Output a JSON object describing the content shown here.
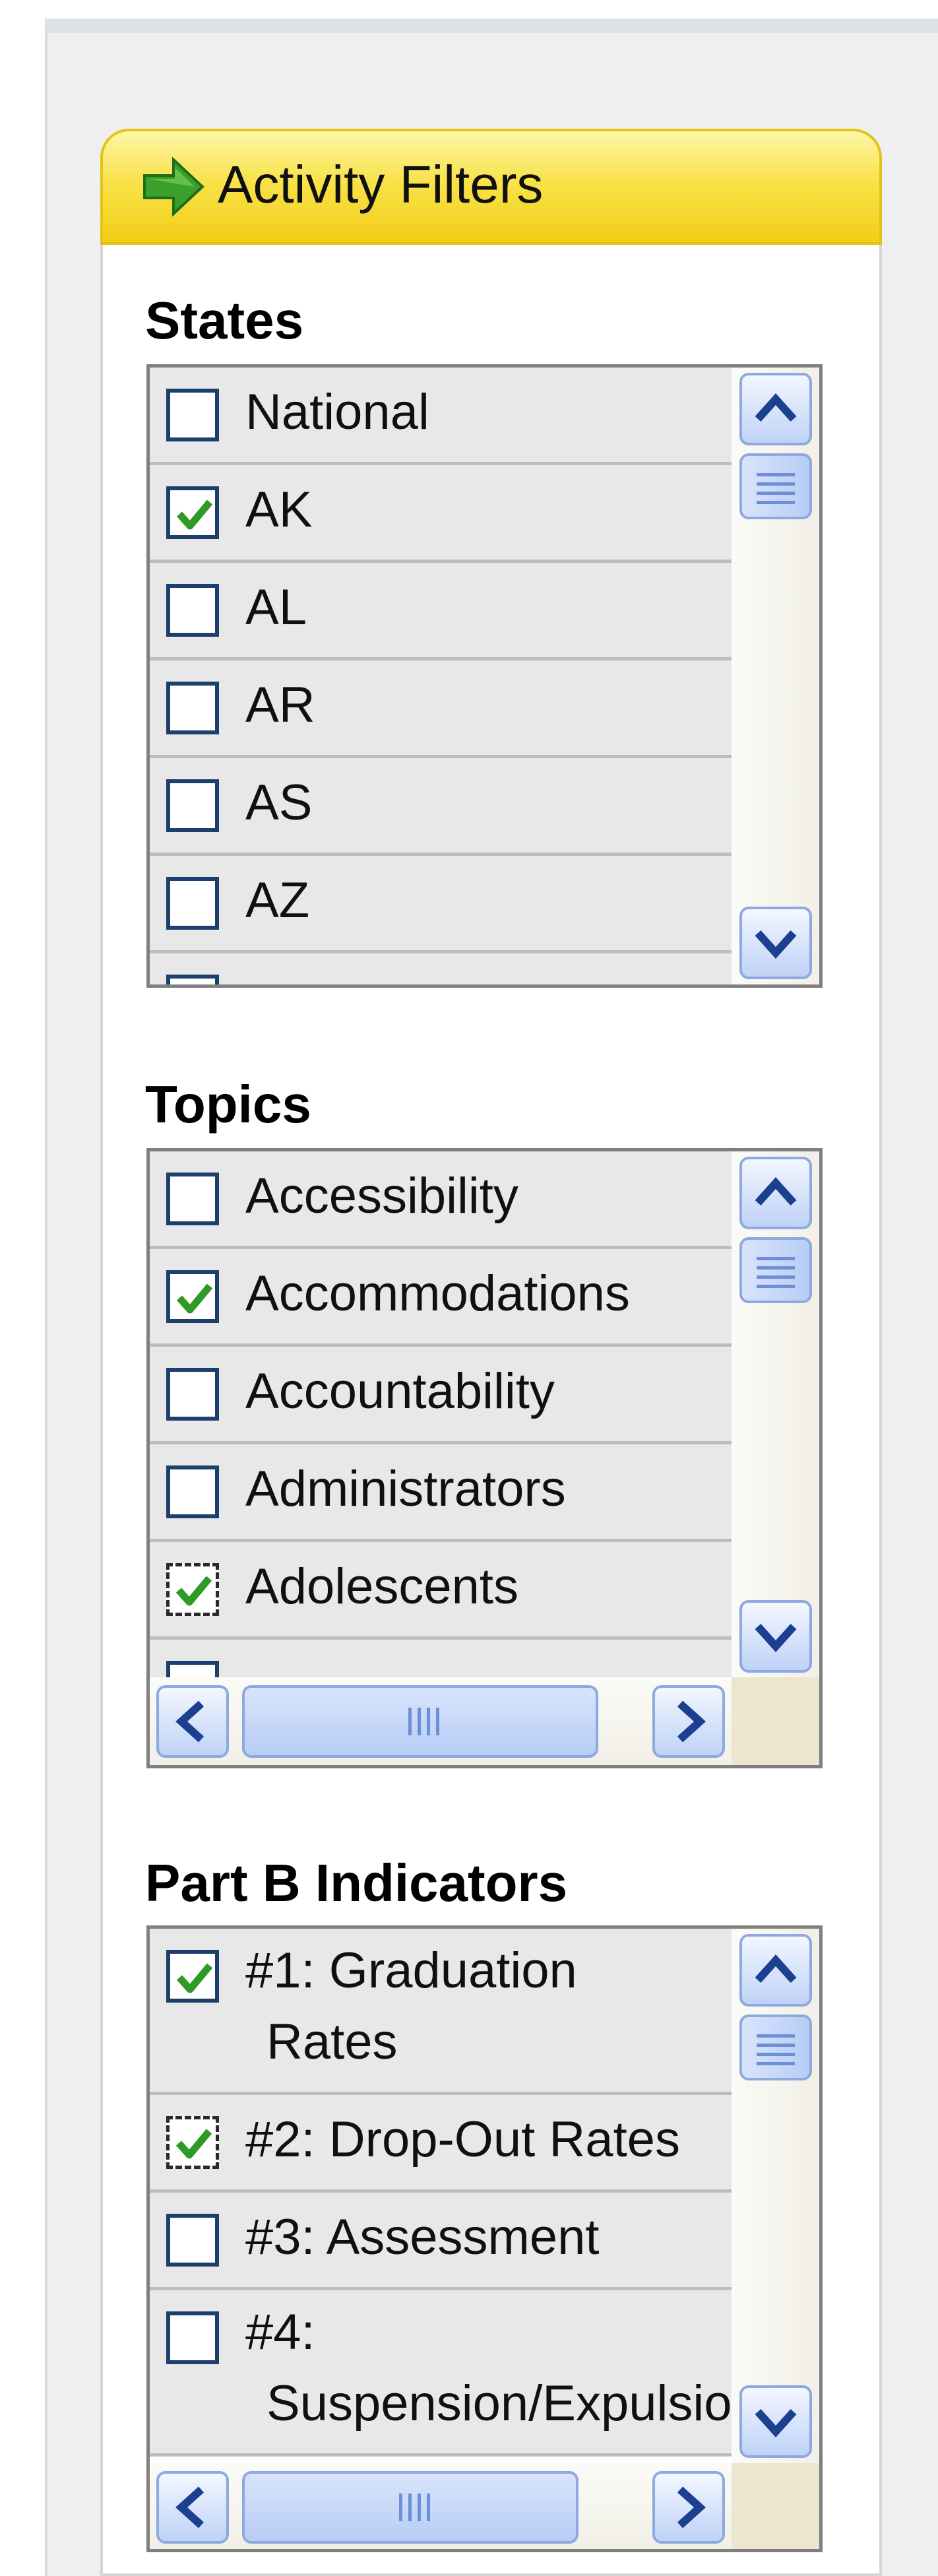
{
  "panel": {
    "title": "Activity Filters",
    "header_icon": "green-arrow-icon",
    "header_color": "#f6dc2e"
  },
  "states": {
    "title": "States",
    "items": [
      {
        "label": "National",
        "checked": false
      },
      {
        "label": "AK",
        "checked": true
      },
      {
        "label": "AL",
        "checked": false
      },
      {
        "label": "AR",
        "checked": false
      },
      {
        "label": "AS",
        "checked": false
      },
      {
        "label": "AZ",
        "checked": false
      }
    ]
  },
  "topics": {
    "title": "Topics",
    "items": [
      {
        "label": "Accessibility",
        "checked": false
      },
      {
        "label": "Accommodations",
        "checked": true
      },
      {
        "label": "Accountability",
        "checked": false
      },
      {
        "label": "Administrators",
        "checked": false
      },
      {
        "label": "Adolescents",
        "checked": true,
        "focused": true
      }
    ]
  },
  "part_b": {
    "title": "Part B Indicators",
    "items": [
      {
        "label_line1": "#1: Graduation",
        "label_line2": "Rates",
        "checked": true
      },
      {
        "label": "#2: Drop-Out Rates",
        "checked": true,
        "focused": true
      },
      {
        "label": "#3: Assessment",
        "checked": false
      },
      {
        "label_line1": "#4:",
        "label_line2": "Suspension/Expulsion",
        "checked": false
      }
    ]
  },
  "colors": {
    "check_green": "#2f9a26",
    "checkbox_border": "#1c3f6b",
    "row_bg": "#e8e8e8",
    "scroll_blue": "#bfd2f7"
  }
}
